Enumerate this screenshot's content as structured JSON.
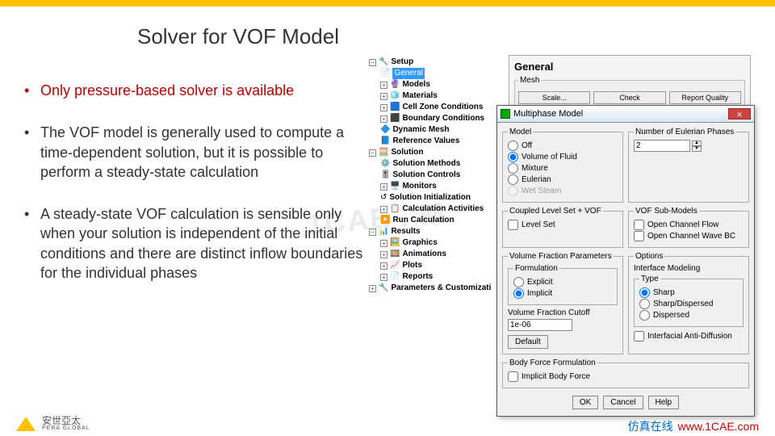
{
  "slide": {
    "title": "Solver for VOF Model",
    "bullets": [
      "Only pressure-based solver is available",
      "The VOF model is  generally used to compute a time-dependent solution, but it is possible to perform a steady-state calculation",
      "A steady-state VOF calculation is sensible only when your solution is independent of the initial conditions and there are distinct inflow boundaries for the individual phases"
    ],
    "logo_text_cn": "安世亞太",
    "logo_text_en": "PERA GLOBAL",
    "footer_cn": "仿真在线",
    "footer_url": "www.1CAE.com",
    "watermark": "1CAE . M"
  },
  "tree": {
    "setup": "Setup",
    "general": "General",
    "models": "Models",
    "materials": "Materials",
    "cellzone": "Cell Zone Conditions",
    "boundary": "Boundary Conditions",
    "dynmesh": "Dynamic Mesh",
    "refvals": "Reference Values",
    "solution": "Solution",
    "methods": "Solution Methods",
    "controls": "Solution Controls",
    "monitors": "Monitors",
    "init": "Solution Initialization",
    "calcact": "Calculation Activities",
    "runcalc": "Run Calculation",
    "results": "Results",
    "graphics": "Graphics",
    "anim": "Animations",
    "plots": "Plots",
    "reports": "Reports",
    "params": "Parameters & Customizati"
  },
  "general": {
    "header": "General",
    "mesh_group": "Mesh",
    "scale_btn": "Scale...",
    "check_btn": "Check",
    "quality_btn": "Report Quality"
  },
  "dialog": {
    "title": "Multiphase Model",
    "model_group": "Model",
    "off": "Off",
    "vof": "Volume of Fluid",
    "mixture": "Mixture",
    "eulerian": "Eulerian",
    "wetsteam": "Wet Steam",
    "phases_group": "Number of Eulerian Phases",
    "phases_val": "2",
    "coupled_group": "Coupled Level Set + VOF",
    "levelset": "Level Set",
    "submodels_group": "VOF Sub-Models",
    "openchan": "Open Channel Flow",
    "openchanw": "Open Channel Wave BC",
    "vfp_group": "Volume Fraction Parameters",
    "formulation": "Formulation",
    "explicit": "Explicit",
    "implicit": "Implicit",
    "cutoff_label": "Volume Fraction Cutoff",
    "cutoff_val": "1e-06",
    "default_btn": "Default",
    "options_group": "Options",
    "intmod": "Interface Modeling",
    "type": "Type",
    "sharp": "Sharp",
    "sharpdisp": "Sharp/Dispersed",
    "dispersed": "Dispersed",
    "antidiff": "Interfacial Anti-Diffusion",
    "bff_group": "Body Force Formulation",
    "impbf": "Implicit Body Force",
    "ok": "OK",
    "cancel": "Cancel",
    "help": "Help"
  }
}
